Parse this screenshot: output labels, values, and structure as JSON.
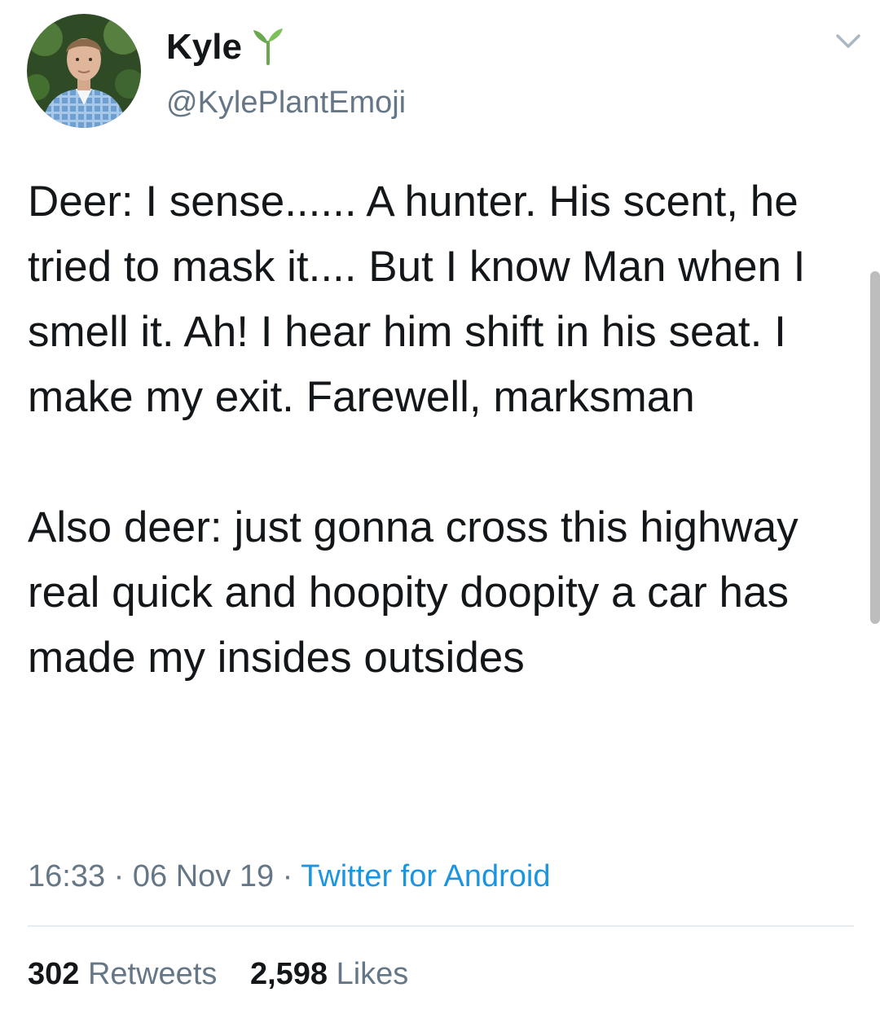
{
  "tweet": {
    "author": {
      "display_name": "Kyle",
      "name_emoji": "seedling-icon",
      "handle": "@KylePlantEmoji"
    },
    "text_paragraphs": [
      "Deer: I sense...... A hunter. His scent, he tried to mask it.... But I know Man when I smell it. Ah! I hear him shift in his seat. I make my exit. Farewell, marksman",
      "Also deer: just gonna cross this highway real quick and hoopity doopity a car has made my insides outsides"
    ],
    "time": "16:33",
    "date": "06 Nov 19",
    "separator": "·",
    "source": "Twitter for Android",
    "retweets": {
      "count": "302",
      "label": "Retweets"
    },
    "likes": {
      "count": "2,598",
      "label": "Likes"
    }
  },
  "colors": {
    "text": "#14171a",
    "secondary": "#657786",
    "link": "#1b95e0",
    "divider": "#e6ecf0",
    "emoji_green": "#6aa84f"
  },
  "icons": {
    "options": "chevron-down-icon"
  }
}
